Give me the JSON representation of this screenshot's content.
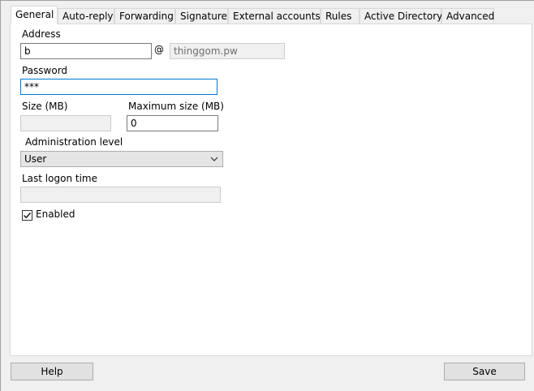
{
  "tabs": [
    {
      "label": "General",
      "active": true
    },
    {
      "label": "Auto-reply"
    },
    {
      "label": "Forwarding"
    },
    {
      "label": "Signature"
    },
    {
      "label": "External accounts"
    },
    {
      "label": "Rules"
    },
    {
      "label": "Active Directory"
    },
    {
      "label": "Advanced"
    }
  ],
  "general": {
    "address_label": "Address",
    "address_value": "b",
    "at_symbol": "@",
    "domain_value": "thinggom.pw",
    "password_label": "Password",
    "password_value": "***",
    "size_label": "Size (MB)",
    "size_value": "",
    "max_size_label": "Maximum size (MB)",
    "max_size_value": "0",
    "admin_level_label": "Administration level",
    "admin_level_value": "User",
    "last_logon_label": "Last logon time",
    "last_logon_value": "",
    "enabled_label": "Enabled",
    "enabled_checked": true
  },
  "footer": {
    "help_label": "Help",
    "save_label": "Save"
  }
}
